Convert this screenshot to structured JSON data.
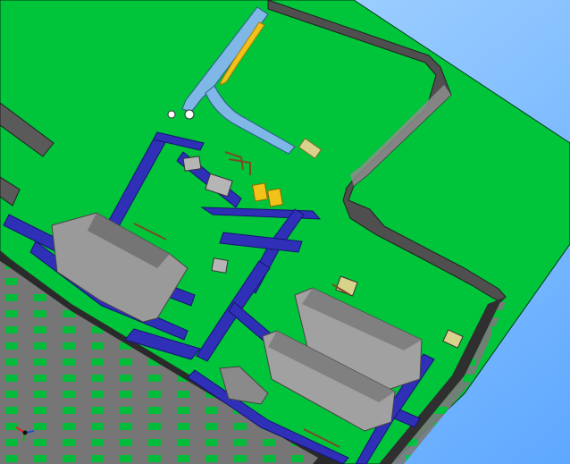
{
  "viewport": {
    "colors": {
      "sky_top": "#a9d6ff",
      "sky_bottom": "#6fb7ff",
      "floor": "#00c43a",
      "wall": "#8c8c8c",
      "wall_dark": "#3f3f3f",
      "wall_window": "#00c43a",
      "conveyor": "#2f2fb8",
      "conveyor_edge": "#15156e",
      "machine_gray": "#9a9a9a",
      "machine_dark": "#5a5a5a",
      "pallet": "#d8d28a",
      "yellow_equipment": "#f2c21b",
      "light_blue_conveyor": "#7fb7e6",
      "brown_structure": "#7a4b24"
    },
    "axis_triad": {
      "x_color": "#d62728",
      "y_color": "#1f4fd6",
      "z_color": "#2ca02c"
    }
  }
}
